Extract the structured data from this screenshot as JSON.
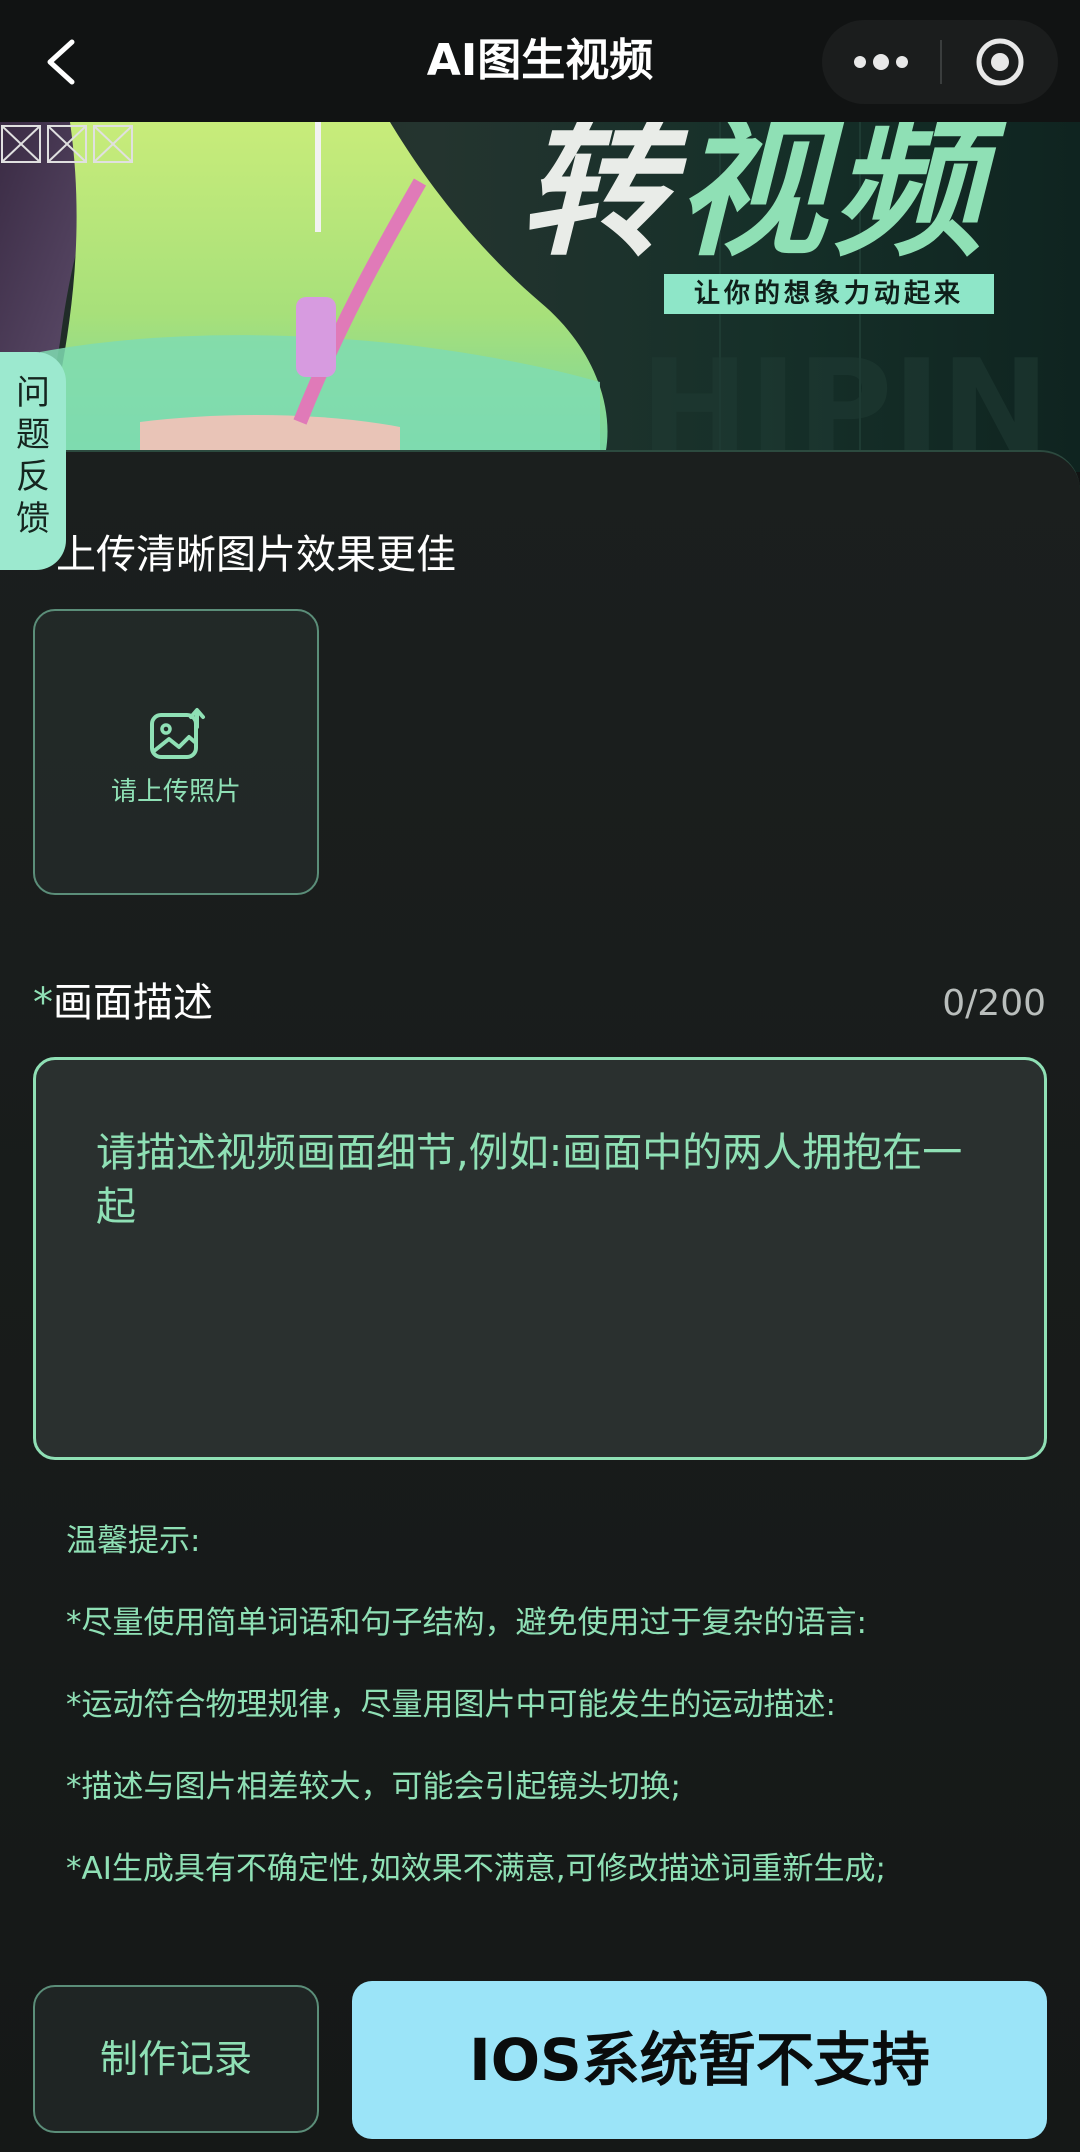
{
  "nav": {
    "title": "AI图生视频",
    "back_icon": "chevron-left-icon",
    "more_icon": "more-dots-icon",
    "target_icon": "target-icon"
  },
  "banner": {
    "headline_part1": "转",
    "headline_part2": "视频",
    "tagline": "让你的想象力动起来"
  },
  "feedback_tab": {
    "chars": [
      "问",
      "题",
      "反",
      "馈"
    ]
  },
  "upload": {
    "hint": "上传清晰图片效果更佳",
    "label": "请上传照片",
    "icon": "image-upload-icon"
  },
  "description": {
    "required_mark": "*",
    "label": "画面描述",
    "counter": "0/200",
    "value": "",
    "placeholder": "请描述视频画面细节,例如:画面中的两人拥抱在一起"
  },
  "tips": {
    "title": "温馨提示:",
    "items": [
      "*尽量使用简单词语和句子结构，避免使用过于复杂的语言:",
      "*运动符合物理规律，尽量用图片中可能发生的运动描述:",
      "*描述与图片相差较大，可能会引起镜头切换;",
      "*AI生成具有不确定性,如效果不满意,可修改描述词重新生成;"
    ]
  },
  "actions": {
    "record_label": "制作记录",
    "submit_label": "IOS系统暂不支持"
  },
  "colors": {
    "accent_green": "#8fe0b5",
    "submit_bg": "#9be4f8",
    "feedback_bg": "#9ce9cf",
    "background": "#121414"
  }
}
